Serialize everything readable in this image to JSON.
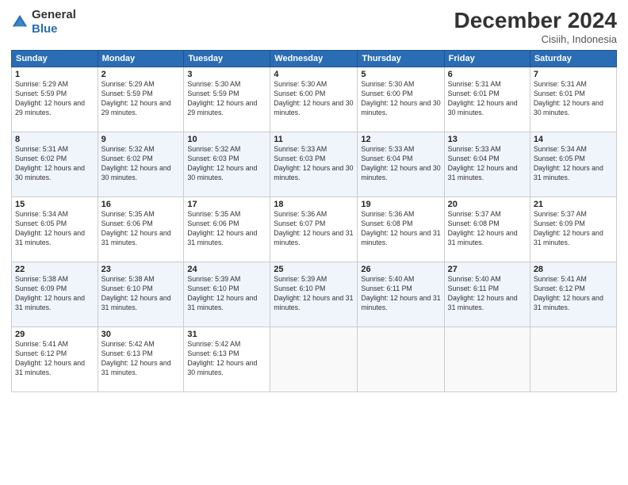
{
  "header": {
    "logo_general": "General",
    "logo_blue": "Blue",
    "month_title": "December 2024",
    "location": "Cisiih, Indonesia"
  },
  "weekdays": [
    "Sunday",
    "Monday",
    "Tuesday",
    "Wednesday",
    "Thursday",
    "Friday",
    "Saturday"
  ],
  "weeks": [
    [
      {
        "day": "1",
        "sunrise": "5:29 AM",
        "sunset": "5:59 PM",
        "daylight": "12 hours and 29 minutes."
      },
      {
        "day": "2",
        "sunrise": "5:29 AM",
        "sunset": "5:59 PM",
        "daylight": "12 hours and 29 minutes."
      },
      {
        "day": "3",
        "sunrise": "5:30 AM",
        "sunset": "5:59 PM",
        "daylight": "12 hours and 29 minutes."
      },
      {
        "day": "4",
        "sunrise": "5:30 AM",
        "sunset": "6:00 PM",
        "daylight": "12 hours and 30 minutes."
      },
      {
        "day": "5",
        "sunrise": "5:30 AM",
        "sunset": "6:00 PM",
        "daylight": "12 hours and 30 minutes."
      },
      {
        "day": "6",
        "sunrise": "5:31 AM",
        "sunset": "6:01 PM",
        "daylight": "12 hours and 30 minutes."
      },
      {
        "day": "7",
        "sunrise": "5:31 AM",
        "sunset": "6:01 PM",
        "daylight": "12 hours and 30 minutes."
      }
    ],
    [
      {
        "day": "8",
        "sunrise": "5:31 AM",
        "sunset": "6:02 PM",
        "daylight": "12 hours and 30 minutes."
      },
      {
        "day": "9",
        "sunrise": "5:32 AM",
        "sunset": "6:02 PM",
        "daylight": "12 hours and 30 minutes."
      },
      {
        "day": "10",
        "sunrise": "5:32 AM",
        "sunset": "6:03 PM",
        "daylight": "12 hours and 30 minutes."
      },
      {
        "day": "11",
        "sunrise": "5:33 AM",
        "sunset": "6:03 PM",
        "daylight": "12 hours and 30 minutes."
      },
      {
        "day": "12",
        "sunrise": "5:33 AM",
        "sunset": "6:04 PM",
        "daylight": "12 hours and 30 minutes."
      },
      {
        "day": "13",
        "sunrise": "5:33 AM",
        "sunset": "6:04 PM",
        "daylight": "12 hours and 31 minutes."
      },
      {
        "day": "14",
        "sunrise": "5:34 AM",
        "sunset": "6:05 PM",
        "daylight": "12 hours and 31 minutes."
      }
    ],
    [
      {
        "day": "15",
        "sunrise": "5:34 AM",
        "sunset": "6:05 PM",
        "daylight": "12 hours and 31 minutes."
      },
      {
        "day": "16",
        "sunrise": "5:35 AM",
        "sunset": "6:06 PM",
        "daylight": "12 hours and 31 minutes."
      },
      {
        "day": "17",
        "sunrise": "5:35 AM",
        "sunset": "6:06 PM",
        "daylight": "12 hours and 31 minutes."
      },
      {
        "day": "18",
        "sunrise": "5:36 AM",
        "sunset": "6:07 PM",
        "daylight": "12 hours and 31 minutes."
      },
      {
        "day": "19",
        "sunrise": "5:36 AM",
        "sunset": "6:08 PM",
        "daylight": "12 hours and 31 minutes."
      },
      {
        "day": "20",
        "sunrise": "5:37 AM",
        "sunset": "6:08 PM",
        "daylight": "12 hours and 31 minutes."
      },
      {
        "day": "21",
        "sunrise": "5:37 AM",
        "sunset": "6:09 PM",
        "daylight": "12 hours and 31 minutes."
      }
    ],
    [
      {
        "day": "22",
        "sunrise": "5:38 AM",
        "sunset": "6:09 PM",
        "daylight": "12 hours and 31 minutes."
      },
      {
        "day": "23",
        "sunrise": "5:38 AM",
        "sunset": "6:10 PM",
        "daylight": "12 hours and 31 minutes."
      },
      {
        "day": "24",
        "sunrise": "5:39 AM",
        "sunset": "6:10 PM",
        "daylight": "12 hours and 31 minutes."
      },
      {
        "day": "25",
        "sunrise": "5:39 AM",
        "sunset": "6:10 PM",
        "daylight": "12 hours and 31 minutes."
      },
      {
        "day": "26",
        "sunrise": "5:40 AM",
        "sunset": "6:11 PM",
        "daylight": "12 hours and 31 minutes."
      },
      {
        "day": "27",
        "sunrise": "5:40 AM",
        "sunset": "6:11 PM",
        "daylight": "12 hours and 31 minutes."
      },
      {
        "day": "28",
        "sunrise": "5:41 AM",
        "sunset": "6:12 PM",
        "daylight": "12 hours and 31 minutes."
      }
    ],
    [
      {
        "day": "29",
        "sunrise": "5:41 AM",
        "sunset": "6:12 PM",
        "daylight": "12 hours and 31 minutes."
      },
      {
        "day": "30",
        "sunrise": "5:42 AM",
        "sunset": "6:13 PM",
        "daylight": "12 hours and 31 minutes."
      },
      {
        "day": "31",
        "sunrise": "5:42 AM",
        "sunset": "6:13 PM",
        "daylight": "12 hours and 30 minutes."
      },
      null,
      null,
      null,
      null
    ]
  ]
}
